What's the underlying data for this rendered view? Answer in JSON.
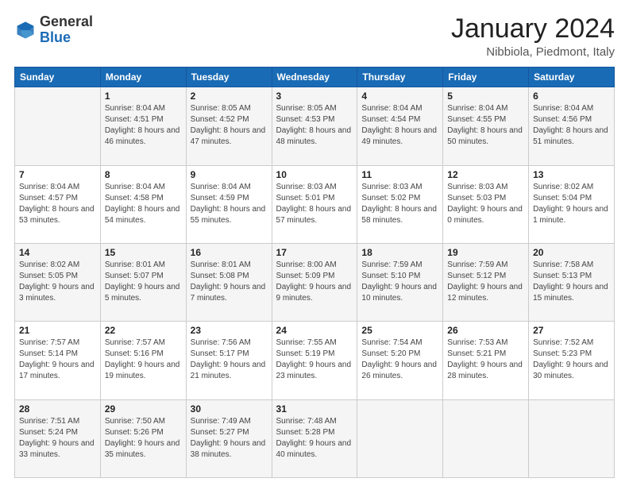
{
  "header": {
    "logo_general": "General",
    "logo_blue": "Blue",
    "month_title": "January 2024",
    "location": "Nibbiola, Piedmont, Italy"
  },
  "weekdays": [
    "Sunday",
    "Monday",
    "Tuesday",
    "Wednesday",
    "Thursday",
    "Friday",
    "Saturday"
  ],
  "weeks": [
    [
      {
        "day": "",
        "sunrise": "",
        "sunset": "",
        "daylight": ""
      },
      {
        "day": "1",
        "sunrise": "Sunrise: 8:04 AM",
        "sunset": "Sunset: 4:51 PM",
        "daylight": "Daylight: 8 hours and 46 minutes."
      },
      {
        "day": "2",
        "sunrise": "Sunrise: 8:05 AM",
        "sunset": "Sunset: 4:52 PM",
        "daylight": "Daylight: 8 hours and 47 minutes."
      },
      {
        "day": "3",
        "sunrise": "Sunrise: 8:05 AM",
        "sunset": "Sunset: 4:53 PM",
        "daylight": "Daylight: 8 hours and 48 minutes."
      },
      {
        "day": "4",
        "sunrise": "Sunrise: 8:04 AM",
        "sunset": "Sunset: 4:54 PM",
        "daylight": "Daylight: 8 hours and 49 minutes."
      },
      {
        "day": "5",
        "sunrise": "Sunrise: 8:04 AM",
        "sunset": "Sunset: 4:55 PM",
        "daylight": "Daylight: 8 hours and 50 minutes."
      },
      {
        "day": "6",
        "sunrise": "Sunrise: 8:04 AM",
        "sunset": "Sunset: 4:56 PM",
        "daylight": "Daylight: 8 hours and 51 minutes."
      }
    ],
    [
      {
        "day": "7",
        "sunrise": "Sunrise: 8:04 AM",
        "sunset": "Sunset: 4:57 PM",
        "daylight": "Daylight: 8 hours and 53 minutes."
      },
      {
        "day": "8",
        "sunrise": "Sunrise: 8:04 AM",
        "sunset": "Sunset: 4:58 PM",
        "daylight": "Daylight: 8 hours and 54 minutes."
      },
      {
        "day": "9",
        "sunrise": "Sunrise: 8:04 AM",
        "sunset": "Sunset: 4:59 PM",
        "daylight": "Daylight: 8 hours and 55 minutes."
      },
      {
        "day": "10",
        "sunrise": "Sunrise: 8:03 AM",
        "sunset": "Sunset: 5:01 PM",
        "daylight": "Daylight: 8 hours and 57 minutes."
      },
      {
        "day": "11",
        "sunrise": "Sunrise: 8:03 AM",
        "sunset": "Sunset: 5:02 PM",
        "daylight": "Daylight: 8 hours and 58 minutes."
      },
      {
        "day": "12",
        "sunrise": "Sunrise: 8:03 AM",
        "sunset": "Sunset: 5:03 PM",
        "daylight": "Daylight: 9 hours and 0 minutes."
      },
      {
        "day": "13",
        "sunrise": "Sunrise: 8:02 AM",
        "sunset": "Sunset: 5:04 PM",
        "daylight": "Daylight: 9 hours and 1 minute."
      }
    ],
    [
      {
        "day": "14",
        "sunrise": "Sunrise: 8:02 AM",
        "sunset": "Sunset: 5:05 PM",
        "daylight": "Daylight: 9 hours and 3 minutes."
      },
      {
        "day": "15",
        "sunrise": "Sunrise: 8:01 AM",
        "sunset": "Sunset: 5:07 PM",
        "daylight": "Daylight: 9 hours and 5 minutes."
      },
      {
        "day": "16",
        "sunrise": "Sunrise: 8:01 AM",
        "sunset": "Sunset: 5:08 PM",
        "daylight": "Daylight: 9 hours and 7 minutes."
      },
      {
        "day": "17",
        "sunrise": "Sunrise: 8:00 AM",
        "sunset": "Sunset: 5:09 PM",
        "daylight": "Daylight: 9 hours and 9 minutes."
      },
      {
        "day": "18",
        "sunrise": "Sunrise: 7:59 AM",
        "sunset": "Sunset: 5:10 PM",
        "daylight": "Daylight: 9 hours and 10 minutes."
      },
      {
        "day": "19",
        "sunrise": "Sunrise: 7:59 AM",
        "sunset": "Sunset: 5:12 PM",
        "daylight": "Daylight: 9 hours and 12 minutes."
      },
      {
        "day": "20",
        "sunrise": "Sunrise: 7:58 AM",
        "sunset": "Sunset: 5:13 PM",
        "daylight": "Daylight: 9 hours and 15 minutes."
      }
    ],
    [
      {
        "day": "21",
        "sunrise": "Sunrise: 7:57 AM",
        "sunset": "Sunset: 5:14 PM",
        "daylight": "Daylight: 9 hours and 17 minutes."
      },
      {
        "day": "22",
        "sunrise": "Sunrise: 7:57 AM",
        "sunset": "Sunset: 5:16 PM",
        "daylight": "Daylight: 9 hours and 19 minutes."
      },
      {
        "day": "23",
        "sunrise": "Sunrise: 7:56 AM",
        "sunset": "Sunset: 5:17 PM",
        "daylight": "Daylight: 9 hours and 21 minutes."
      },
      {
        "day": "24",
        "sunrise": "Sunrise: 7:55 AM",
        "sunset": "Sunset: 5:19 PM",
        "daylight": "Daylight: 9 hours and 23 minutes."
      },
      {
        "day": "25",
        "sunrise": "Sunrise: 7:54 AM",
        "sunset": "Sunset: 5:20 PM",
        "daylight": "Daylight: 9 hours and 26 minutes."
      },
      {
        "day": "26",
        "sunrise": "Sunrise: 7:53 AM",
        "sunset": "Sunset: 5:21 PM",
        "daylight": "Daylight: 9 hours and 28 minutes."
      },
      {
        "day": "27",
        "sunrise": "Sunrise: 7:52 AM",
        "sunset": "Sunset: 5:23 PM",
        "daylight": "Daylight: 9 hours and 30 minutes."
      }
    ],
    [
      {
        "day": "28",
        "sunrise": "Sunrise: 7:51 AM",
        "sunset": "Sunset: 5:24 PM",
        "daylight": "Daylight: 9 hours and 33 minutes."
      },
      {
        "day": "29",
        "sunrise": "Sunrise: 7:50 AM",
        "sunset": "Sunset: 5:26 PM",
        "daylight": "Daylight: 9 hours and 35 minutes."
      },
      {
        "day": "30",
        "sunrise": "Sunrise: 7:49 AM",
        "sunset": "Sunset: 5:27 PM",
        "daylight": "Daylight: 9 hours and 38 minutes."
      },
      {
        "day": "31",
        "sunrise": "Sunrise: 7:48 AM",
        "sunset": "Sunset: 5:28 PM",
        "daylight": "Daylight: 9 hours and 40 minutes."
      },
      {
        "day": "",
        "sunrise": "",
        "sunset": "",
        "daylight": ""
      },
      {
        "day": "",
        "sunrise": "",
        "sunset": "",
        "daylight": ""
      },
      {
        "day": "",
        "sunrise": "",
        "sunset": "",
        "daylight": ""
      }
    ]
  ]
}
